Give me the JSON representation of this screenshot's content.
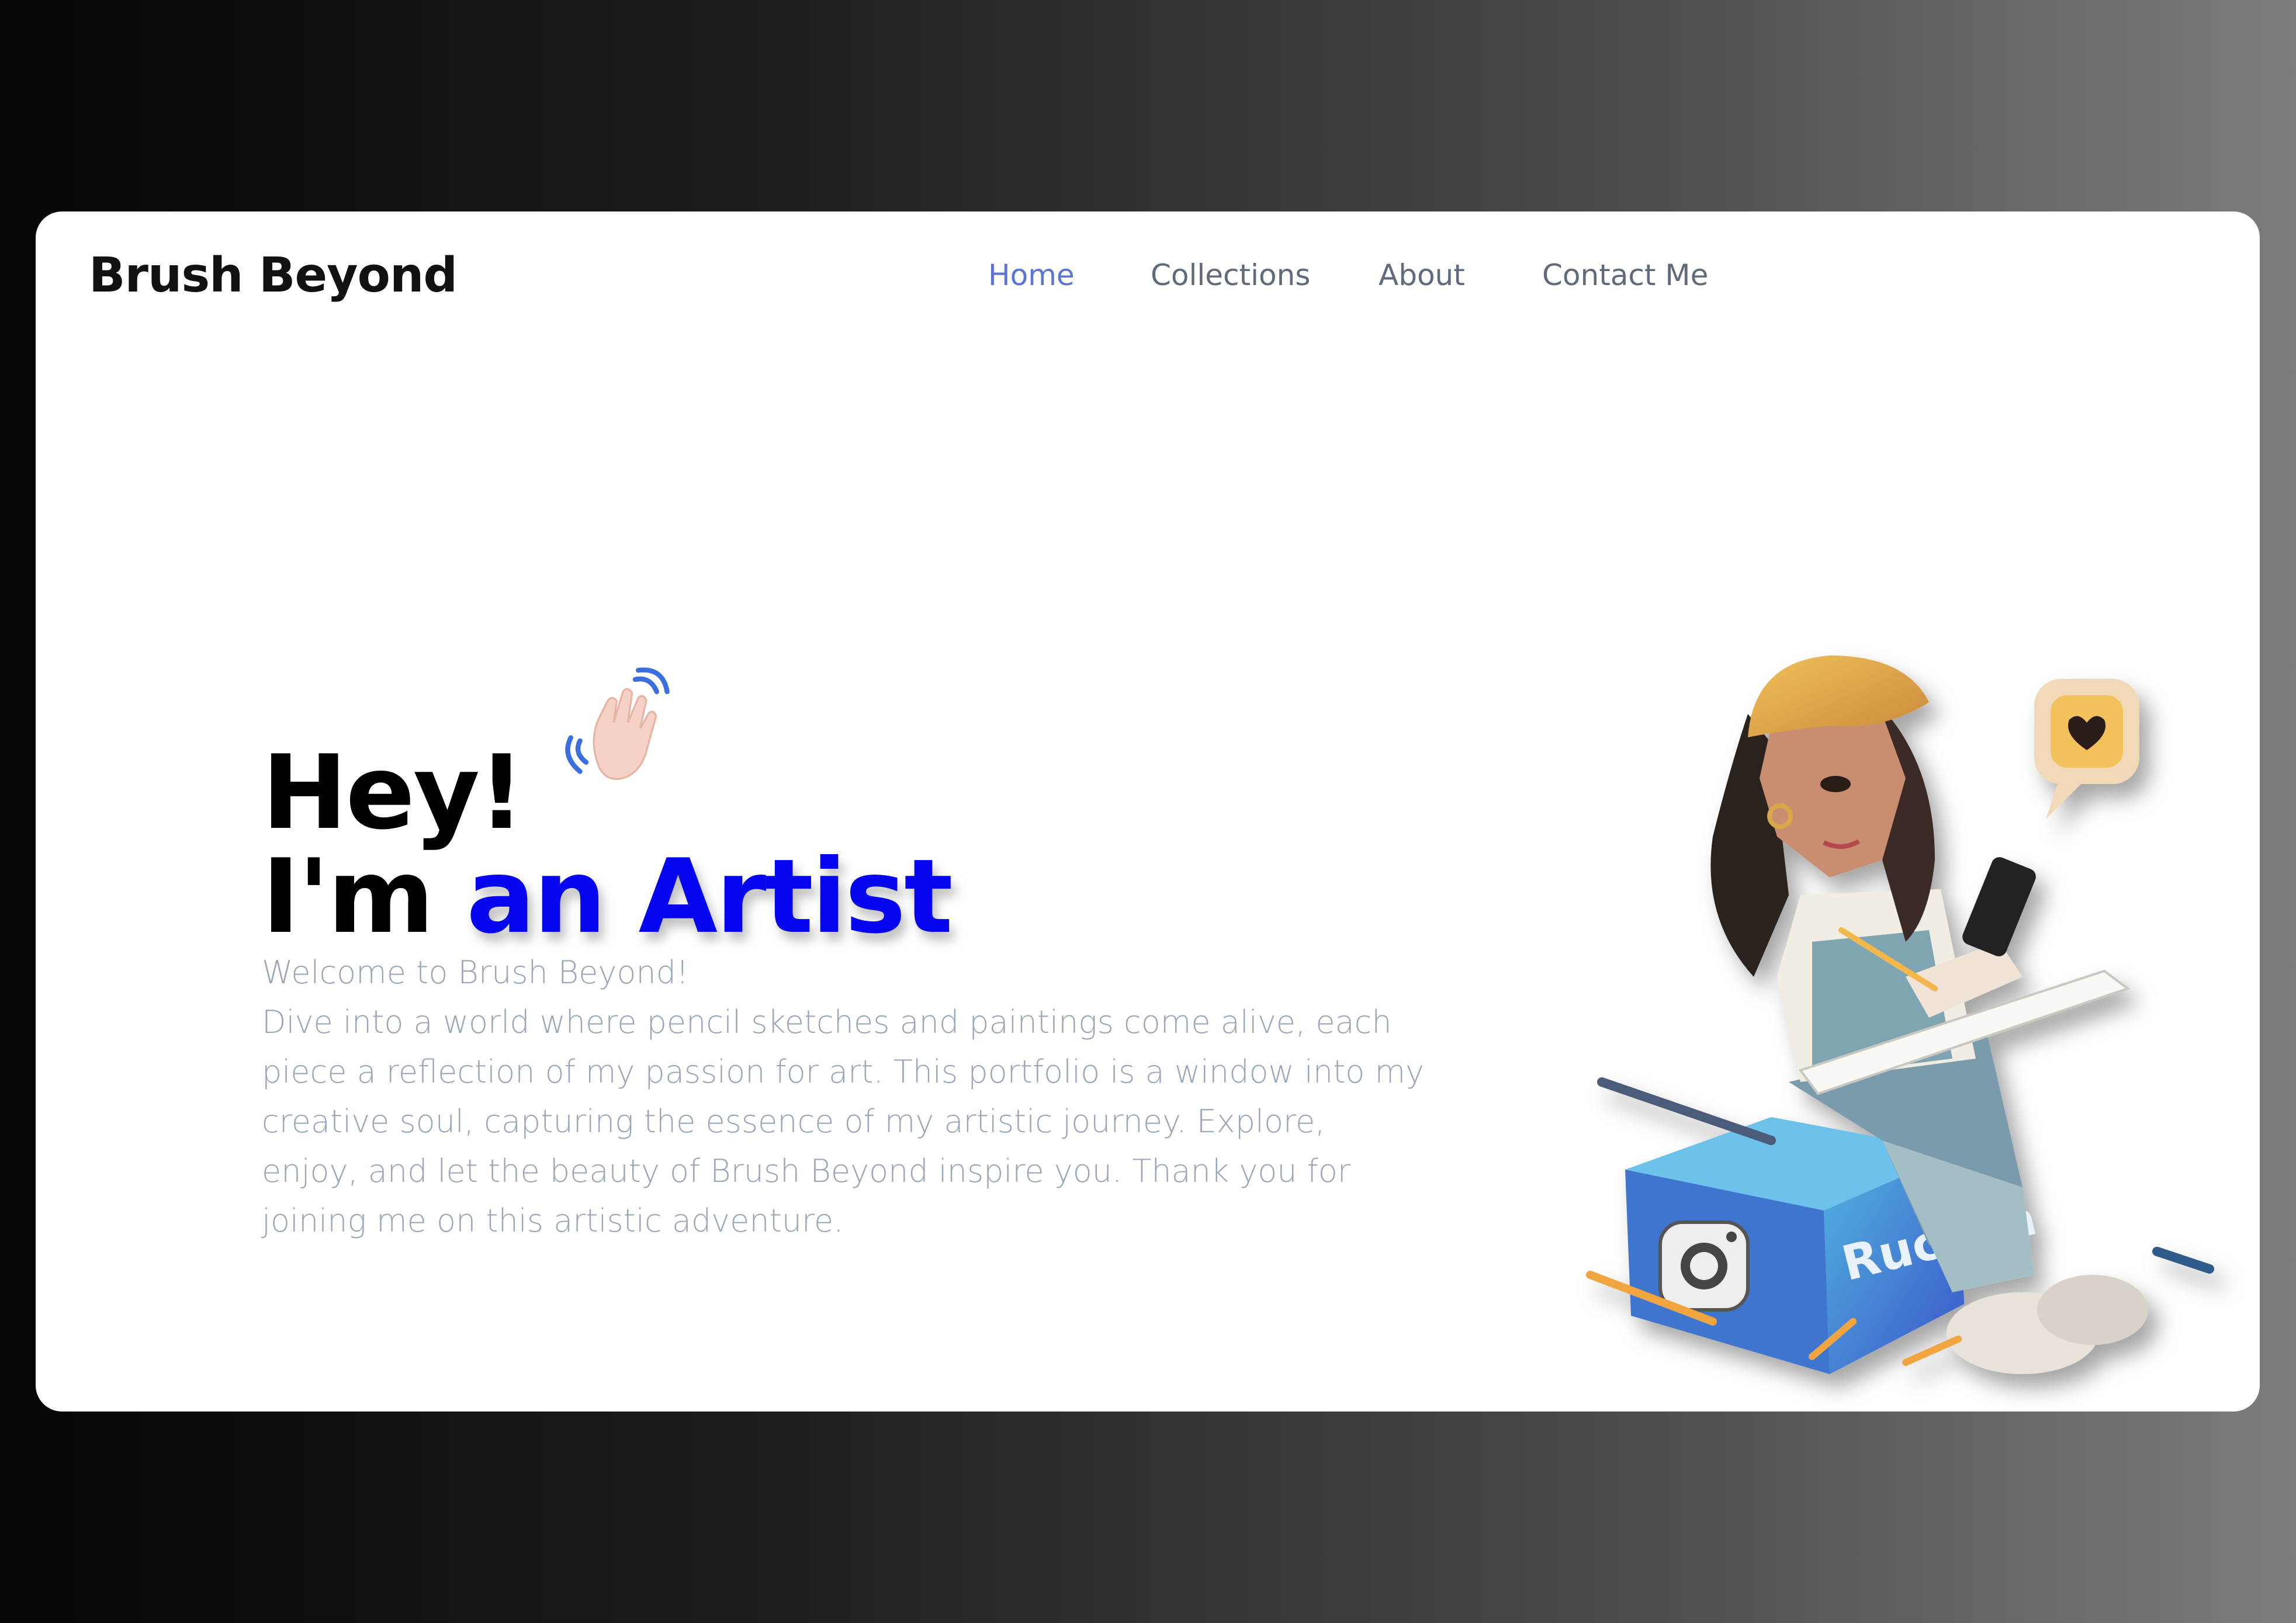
{
  "brand": {
    "name": "Brush Beyond"
  },
  "nav": {
    "items": [
      {
        "label": "Home",
        "active": true
      },
      {
        "label": "Collections",
        "active": false
      },
      {
        "label": "About",
        "active": false
      },
      {
        "label": "Contact Me",
        "active": false
      }
    ]
  },
  "hero": {
    "line1": "Hey!",
    "line2_prefix": "I'm",
    "line2_accent": "an Artist",
    "wave_icon": "waving-hand-icon",
    "intro": "Welcome to Brush Beyond!",
    "body": "Dive into a world where pencil sketches and paintings come alive, each piece a reflection of my passion for art. This portfolio is a window into my creative soul, capturing the essence of my artistic journey. Explore, enjoy, and let the beauty of Brush Beyond inspire you. Thank you for joining me on this artistic adventure."
  },
  "illustration": {
    "box_label": "Ruchka",
    "box_icon": "instagram-icon",
    "bubble_icon": "heart-icon"
  },
  "colors": {
    "accent": "#0505f0",
    "nav_active": "#5b74d6",
    "nav": "#5f6a7d",
    "text_muted": "#9aa7b8"
  }
}
